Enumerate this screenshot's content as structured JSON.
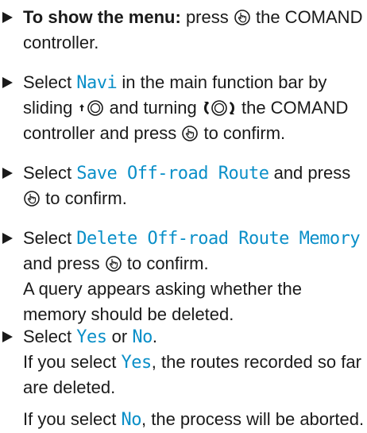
{
  "colors": {
    "text": "#1a1a1a",
    "ui_term": "#0a8fc8"
  },
  "icons": {
    "bullet": "right-triangle-bullet-icon",
    "press": "press-controller-icon",
    "slide": "slide-up-controller-icon",
    "turn": "turn-controller-icon"
  },
  "steps": [
    {
      "lines": [
        {
          "label": "To show the menu:",
          "t1": "press",
          "t2": "the COMAND"
        },
        {
          "text": "controller."
        }
      ]
    },
    {
      "lines": [
        {
          "t1": "Select",
          "ui": "Navi",
          "t2": "in the main function bar by"
        },
        {
          "t1": "sliding",
          "t2": "and turning",
          "t3": "the COMAND"
        },
        {
          "t1": "controller and press",
          "t2": "to confirm."
        }
      ]
    },
    {
      "lines": [
        {
          "t1": "Select",
          "ui": "Save Off-road Route",
          "t2": "and press"
        },
        {
          "t1": "to confirm."
        }
      ]
    },
    {
      "lines": [
        {
          "t1": "Select",
          "ui": "Delete Off-road Route Memory"
        },
        {
          "t1": "and press",
          "t2": "to confirm."
        },
        {
          "text": "A query appears asking whether the"
        },
        {
          "text": "memory should be deleted."
        }
      ]
    },
    {
      "lines": [
        {
          "t1": "Select",
          "ui1": "Yes",
          "t2": "or",
          "ui2": "No",
          "t3": "."
        },
        {
          "t1": "If you select",
          "ui": "Yes",
          "t2": ", the routes recorded so far"
        },
        {
          "text": "are deleted."
        },
        {
          "t1": "If you select",
          "ui": "No",
          "t2": ", the process will be aborted."
        }
      ]
    }
  ]
}
